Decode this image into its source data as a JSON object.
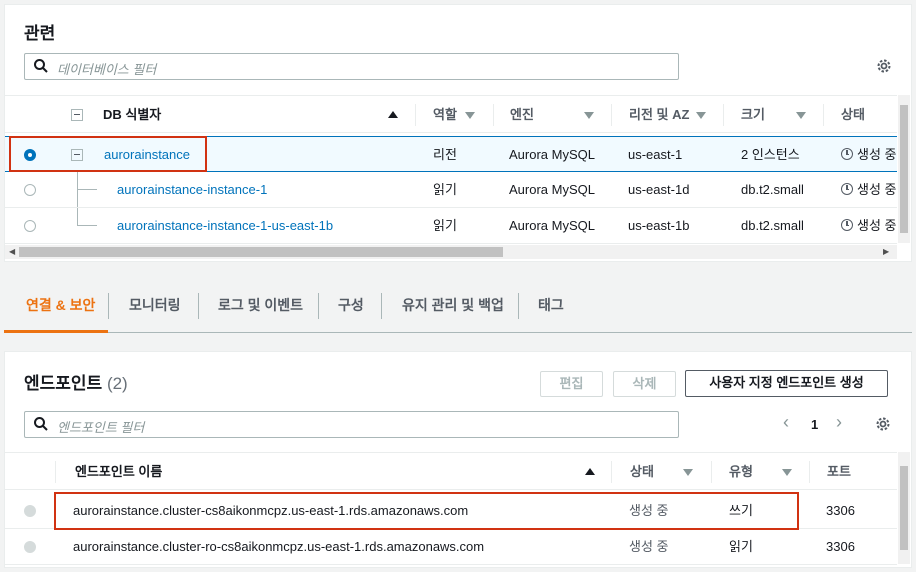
{
  "instances": {
    "title": "관련",
    "filter_placeholder": "데이터베이스 필터",
    "columns": [
      "DB 식별자",
      "역할",
      "엔진",
      "리전 및 AZ",
      "크기",
      "상태"
    ],
    "rows": [
      {
        "id": "aurorainstance",
        "role": "리전",
        "engine": "Aurora MySQL",
        "region": "us-east-1",
        "size": "2 인스턴스",
        "status": "생성 중"
      },
      {
        "id": "aurorainstance-instance-1",
        "role": "읽기",
        "engine": "Aurora MySQL",
        "region": "us-east-1d",
        "size": "db.t2.small",
        "status": "생성 중"
      },
      {
        "id": "aurorainstance-instance-1-us-east-1b",
        "role": "읽기",
        "engine": "Aurora MySQL",
        "region": "us-east-1b",
        "size": "db.t2.small",
        "status": "생성 중"
      }
    ]
  },
  "tabs": [
    "연결 & 보안",
    "모니터링",
    "로그 및 이벤트",
    "구성",
    "유지 관리 및 백업",
    "태그"
  ],
  "endpoints": {
    "title": "엔드포인트",
    "count": "(2)",
    "edit_label": "편집",
    "delete_label": "삭제",
    "create_label": "사용자 지정 엔드포인트 생성",
    "filter_placeholder": "엔드포인트 필터",
    "page": "1",
    "columns": [
      "엔드포인트 이름",
      "상태",
      "유형",
      "포트"
    ],
    "rows": [
      {
        "name": "aurorainstance.cluster-cs8aikonmcpz.us-east-1.rds.amazonaws.com",
        "status": "생성 중",
        "type": "쓰기",
        "port": "3306"
      },
      {
        "name": "aurorainstance.cluster-ro-cs8aikonmcpz.us-east-1.rds.amazonaws.com",
        "status": "생성 중",
        "type": "읽기",
        "port": "3306"
      }
    ]
  },
  "colors": {
    "accent": "#ec7211",
    "link": "#0073bb",
    "highlight": "#d13212"
  }
}
